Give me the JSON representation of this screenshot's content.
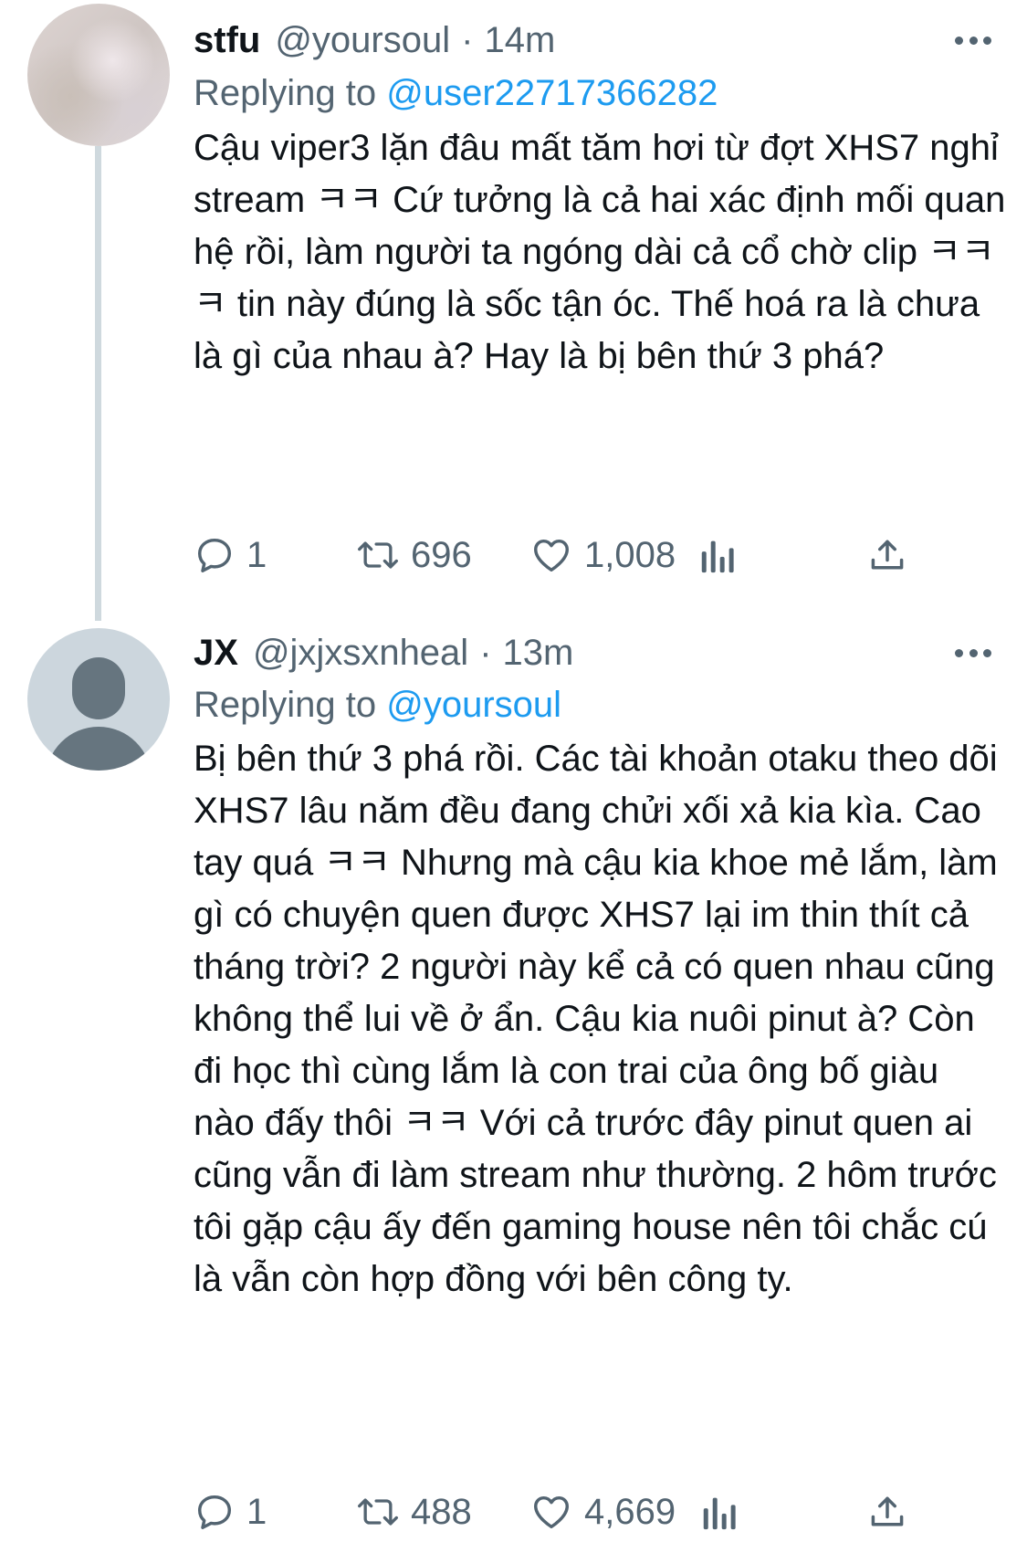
{
  "tweets": [
    {
      "display_name": "stfu",
      "handle": "@yoursoul",
      "separator": "·",
      "time": "14m",
      "replying_label": "Replying to",
      "replying_to": "@user22717366282",
      "text": "Cậu viper3 lặn đâu mất tăm hơi từ đợt XHS7 nghỉ stream ㅋㅋ Cứ tưởng là cả hai xác định mối quan hệ rồi, làm người ta ngóng dài cả cổ chờ clip ㅋㅋㅋ tin này đúng là sốc tận óc. Thế hoá ra là chưa là gì của nhau à? Hay là bị bên thứ 3 phá?",
      "replies": "1",
      "retweets": "696",
      "likes": "1,008",
      "avatar": "textured-photo"
    },
    {
      "display_name": "JX",
      "handle": "@jxjxsxnheal",
      "separator": "·",
      "time": "13m",
      "replying_label": "Replying to",
      "replying_to": "@yoursoul",
      "text": "Bị bên thứ 3 phá rồi. Các tài khoản otaku theo dõi XHS7 lâu năm đều đang chửi xối xả kia kìa. Cao tay quá ㅋㅋ Nhưng mà cậu kia khoe mẻ lắm, làm gì có chuyện quen được XHS7 lại im thin thít cả tháng trời? 2 người này kể cả có quen nhau cũng không thể lui về ở ẩn. Cậu kia nuôi pinut à? Còn đi học thì cùng lắm là con trai của ông bố giàu nào đấy thôi ㅋㅋ Với cả trước đây pinut quen ai cũng vẫn đi làm stream như thường. 2 hôm trước tôi gặp cậu ấy đến gaming house nên tôi chắc cú là vẫn còn hợp đồng với bên công ty.",
      "replies": "1",
      "retweets": "488",
      "likes": "4,669",
      "avatar": "default-profile"
    }
  ],
  "icons": {
    "reply": "speech-bubble-icon",
    "retweet": "retweet-arrows-icon",
    "like": "heart-icon",
    "analytics": "bar-chart-icon",
    "share": "share-upload-icon",
    "more": "more-dots-icon"
  },
  "colors": {
    "text": "#0f1419",
    "secondary": "#536471",
    "link": "#1d9bf0",
    "thread_line": "#cfd9de"
  }
}
